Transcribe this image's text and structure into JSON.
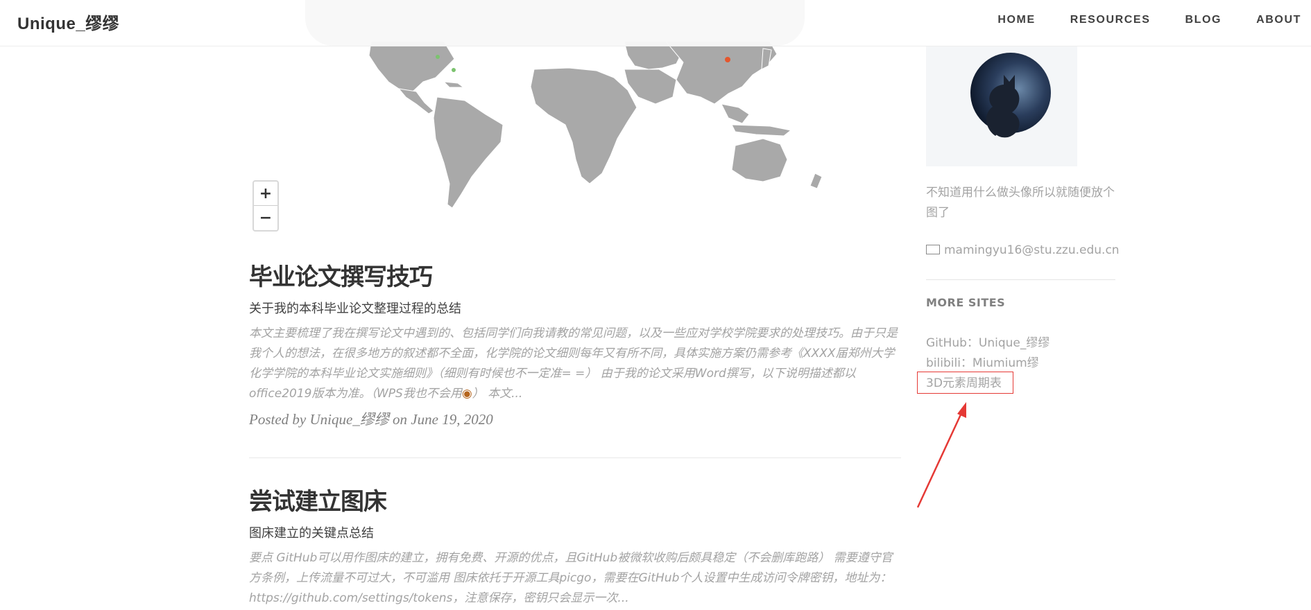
{
  "nav": {
    "brand": "Unique_缪缪",
    "links": [
      "HOME",
      "RESOURCES",
      "BLOG",
      "ABOUT"
    ]
  },
  "map": {
    "zoom_in": "+",
    "zoom_out": "−"
  },
  "posts": [
    {
      "title": "毕业论文撰写技巧",
      "subtitle": "关于我的本科毕业论文整理过程的总结",
      "excerpt": "本文主要梳理了我在撰写论文中遇到的、包括同学们向我请教的常见问题，以及一些应对学校学院要求的处理技巧。由于只是我个人的想法，在很多地方的叙述都不全面，化学院的论文细则每年又有所不同，具体实施方案仍需参考《XXXX届郑州大学化学学院的本科毕业论文实施细则》（细则有时候也不一定准= =） 由于我的论文采用Word撰写，以下说明描述都以office2019版本为准。（WPS我也不会用",
      "excerpt_tail": "） 本文...",
      "meta": "Posted by Unique_缪缪 on June 19, 2020"
    },
    {
      "title": "尝试建立图床",
      "subtitle": "图床建立的关键点总结",
      "excerpt": "要点 GitHub可以用作图床的建立，拥有免费、开源的优点，且GitHub被微软收购后颇具稳定（不会删库跑路） 需要遵守官方条例，上传流量不可过大，不可滥用 图床依托于开源工具picgo，需要在GitHub个人设置中生成访问令牌密钥，地址为：https://github.com/settings/tokens，注意保存，密钥只会显示一次..."
    }
  ],
  "sidebar": {
    "description": "不知道用什么做头像所以就随便放个图了",
    "email": "mamingyu16@stu.zzu.edu.cn",
    "more_sites_heading": "MORE SITES",
    "sites": [
      "GitHub：Unique_缪缪",
      "bilibili：Miumium缪",
      "3D元素周期表"
    ]
  },
  "colors": {
    "highlight": "#e53935",
    "map_land": "#a9a9a9"
  }
}
